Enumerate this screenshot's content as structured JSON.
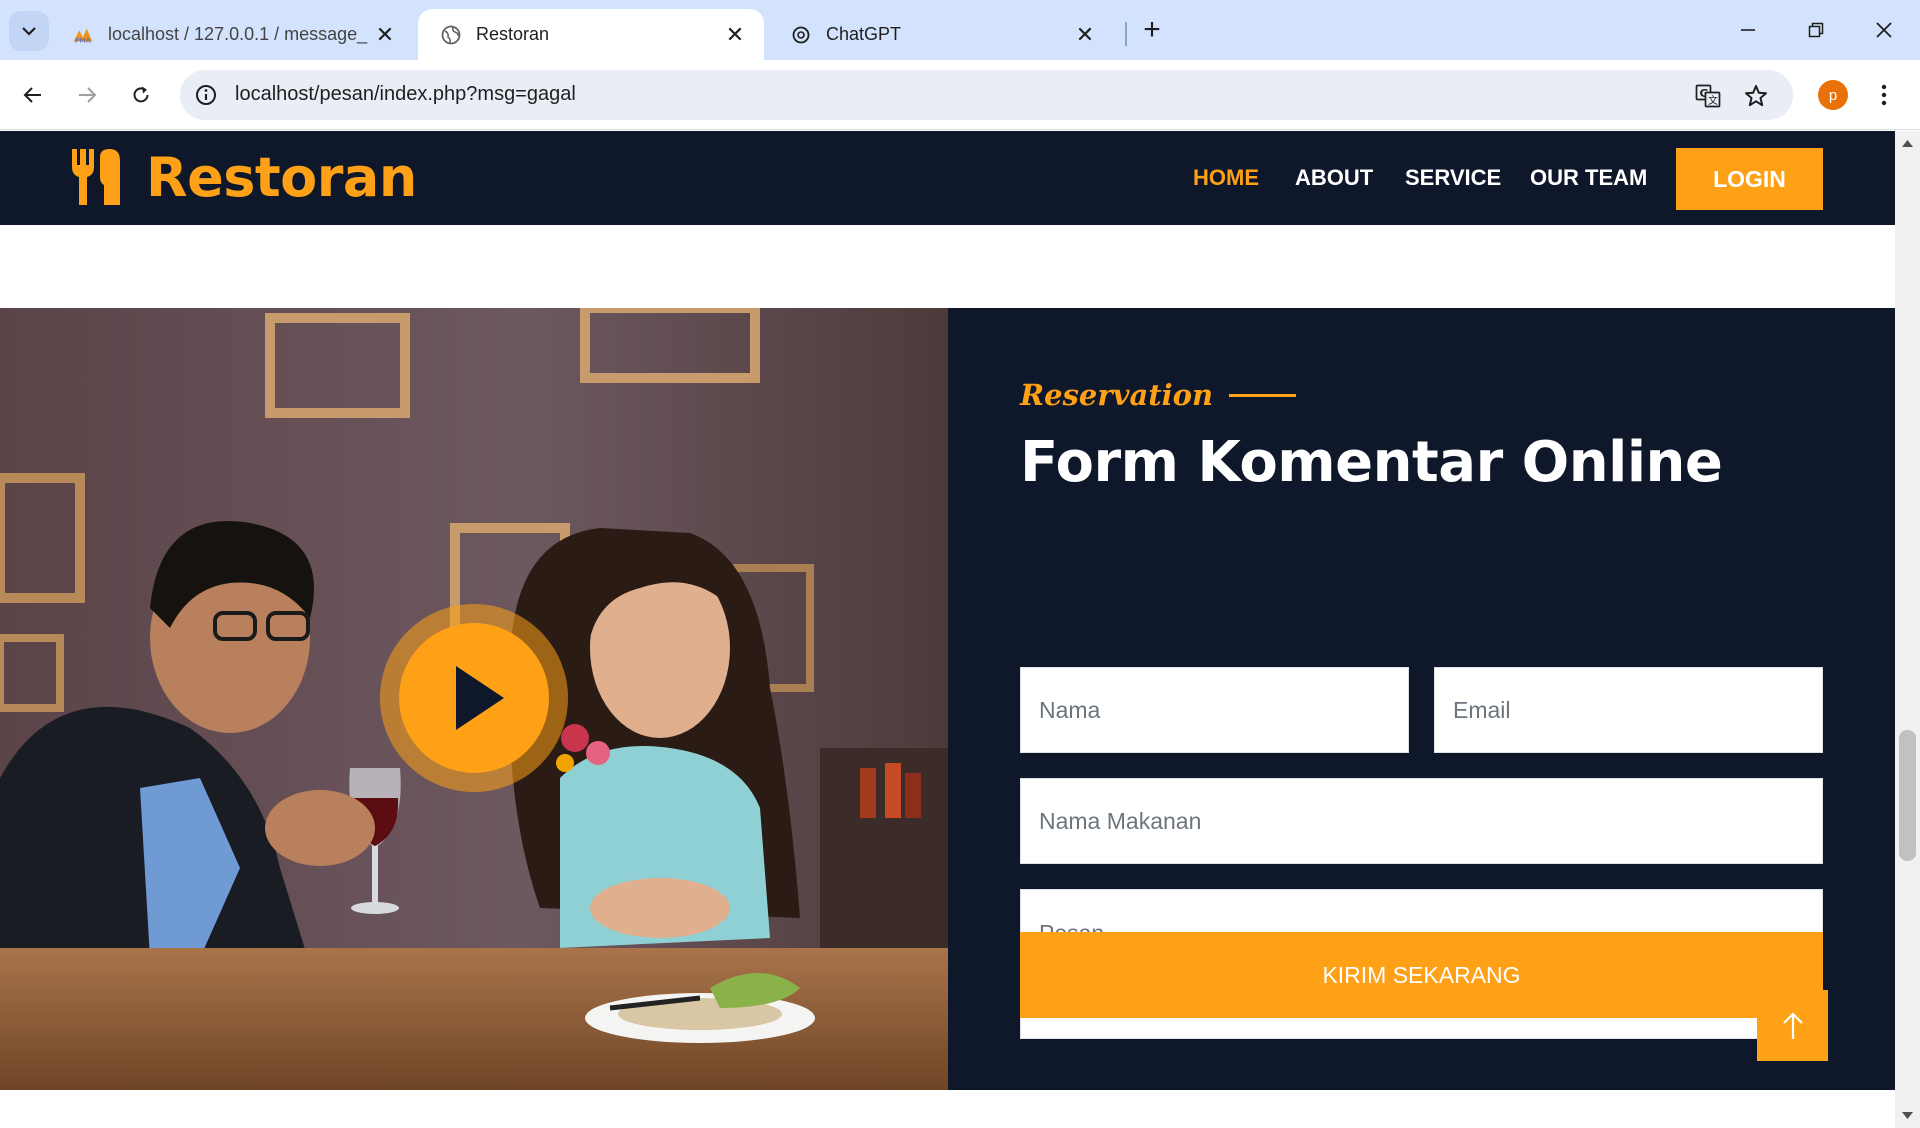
{
  "browser": {
    "tabs": [
      {
        "title": "localhost / 127.0.0.1 / message_",
        "favicon": "phpmyadmin-icon",
        "active": false
      },
      {
        "title": "Restoran",
        "favicon": "globe-icon",
        "active": true
      },
      {
        "title": "ChatGPT",
        "favicon": "chatgpt-icon",
        "active": false
      }
    ],
    "url": "localhost/pesan/index.php?msg=gagal",
    "profile_initial": "p"
  },
  "site": {
    "brand": "Restoran",
    "menu": [
      "HOME",
      "ABOUT",
      "SERVICE",
      "OUR TEAM"
    ],
    "active_menu": "HOME",
    "login_label": "LOGIN"
  },
  "reservation": {
    "subtitle": "Reservation",
    "heading": "Form Komentar Online",
    "fields": {
      "name_placeholder": "Nama",
      "email_placeholder": "Email",
      "food_placeholder": "Nama Makanan",
      "message_placeholder": "Pesan"
    },
    "submit_label": "KIRIM SEKARANG"
  },
  "colors": {
    "accent": "#fea116",
    "dark": "#0f172b",
    "chrome_tabstrip": "#d3e3fd"
  }
}
